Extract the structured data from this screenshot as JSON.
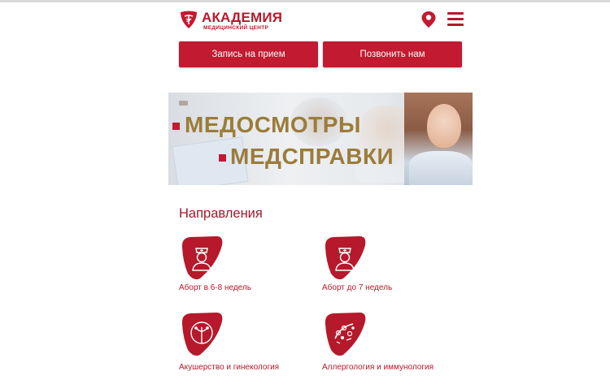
{
  "header": {
    "brand_name": "АКАДЕМИЯ",
    "brand_subtitle": "МЕДИЦИНСКИЙ ЦЕНТР",
    "icons": [
      "location-pin-icon",
      "menu-icon"
    ]
  },
  "actions": {
    "appointment_label": "Запись на прием",
    "call_label": "Позвонить нам"
  },
  "banner": {
    "line1": "МЕДОСМОТРЫ",
    "line2": "МЕДСПРАВКИ"
  },
  "directions": {
    "title": "Направления",
    "items": [
      {
        "label": "Аборт в 6-8 недель",
        "icon": "nurse-icon"
      },
      {
        "label": "Аборт до 7 недель",
        "icon": "nurse-icon"
      },
      {
        "label": "Акушерство и гинекология",
        "icon": "female-reproductive-icon"
      },
      {
        "label": "Аллергология и иммунология",
        "icon": "allergy-cells-icon"
      }
    ]
  },
  "colors": {
    "brand_red": "#c21a30",
    "title_red": "#a3192c",
    "banner_gold": "#9c7c3a"
  }
}
